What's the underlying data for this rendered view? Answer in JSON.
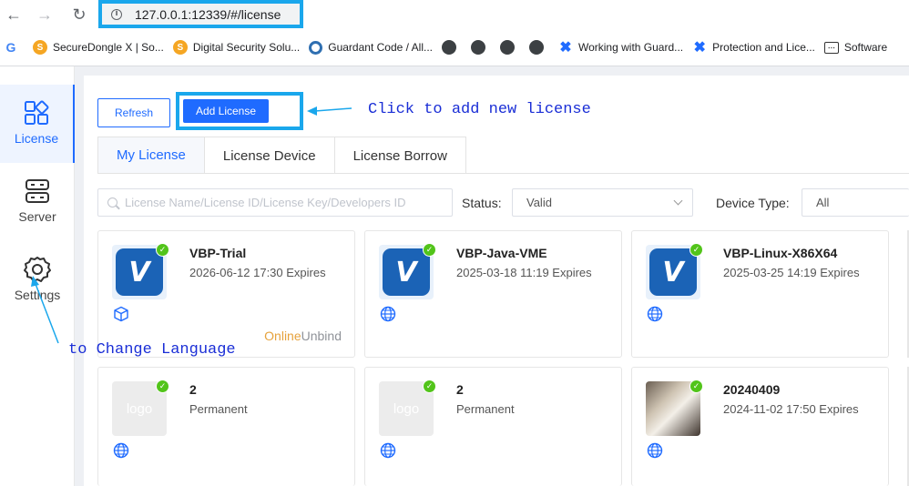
{
  "browser": {
    "url": "127.0.0.1:12339/#/license",
    "bookmarks": [
      {
        "label": "SecureDongle X | So...",
        "icon": "orange-s-icon"
      },
      {
        "label": "Digital Security Solu...",
        "icon": "orange-s-icon"
      },
      {
        "label": "Guardant Code / All...",
        "icon": "guardant-icon"
      },
      {
        "label": "",
        "icon": "globe-icon"
      },
      {
        "label": "",
        "icon": "globe-icon"
      },
      {
        "label": "",
        "icon": "globe-icon"
      },
      {
        "label": "",
        "icon": "globe-icon"
      },
      {
        "label": "Working with Guard...",
        "icon": "confluence-icon"
      },
      {
        "label": "Protection and Lice...",
        "icon": "confluence-icon"
      },
      {
        "label": "Software",
        "icon": "keyboard-icon"
      }
    ]
  },
  "sidebar": {
    "items": [
      {
        "label": "License",
        "icon": "grid-icon",
        "active": true
      },
      {
        "label": "Server",
        "icon": "server-icon",
        "active": false
      },
      {
        "label": "Settings",
        "icon": "gear-icon",
        "active": false
      }
    ]
  },
  "toolbar": {
    "refresh_label": "Refresh",
    "add_label": "Add License"
  },
  "tabs": [
    {
      "label": "My License",
      "active": true
    },
    {
      "label": "License Device",
      "active": false
    },
    {
      "label": "License Borrow",
      "active": false
    }
  ],
  "filters": {
    "search_placeholder": "License Name/License ID/License Key/Developers ID",
    "status_label": "Status:",
    "status_value": "Valid",
    "device_type_label": "Device Type:",
    "device_type_value": "All"
  },
  "cards": [
    {
      "name": "VBP-Trial",
      "expires": "2026-06-12 17:30 Expires",
      "image": "V",
      "type_icon": "cube-icon",
      "actions": {
        "online": "Online",
        "unbind": "Unbind"
      }
    },
    {
      "name": "VBP-Java-VME",
      "expires": "2025-03-18 11:19 Expires",
      "image": "V",
      "type_icon": "globe-icon"
    },
    {
      "name": "VBP-Linux-X86X64",
      "expires": "2025-03-25 14:19 Expires",
      "image": "V",
      "type_icon": "globe-icon"
    },
    {
      "name": "2",
      "expires": "Permanent",
      "image": "logo",
      "type_icon": "globe-icon"
    },
    {
      "name": "2",
      "expires": "Permanent",
      "image": "logo",
      "type_icon": "globe-icon"
    },
    {
      "name": "20240409",
      "expires": "2024-11-02 17:50 Expires",
      "image": "photo",
      "type_icon": "globe-icon"
    }
  ],
  "annotations": {
    "add_license": "Click to add new license",
    "settings": "to Change Language"
  },
  "colors": {
    "primary": "#1f6bff",
    "highlight_box": "#1aa7ec",
    "annotation_text": "#1a2ed6",
    "valid_check": "#52c41a",
    "online": "#e6a23c"
  }
}
